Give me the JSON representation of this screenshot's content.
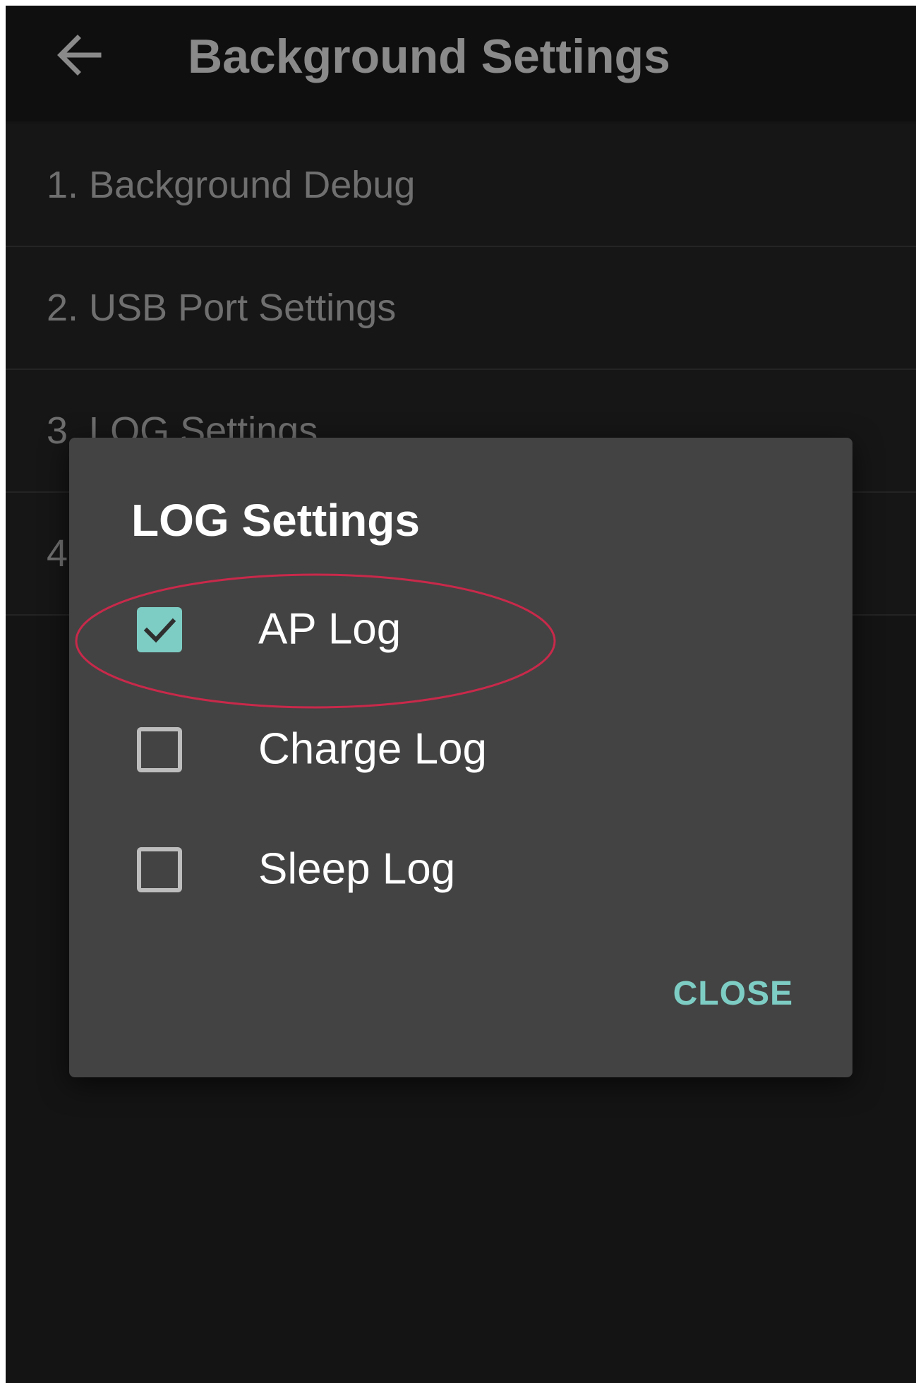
{
  "toolbar": {
    "title": "Background Settings",
    "back_icon": "arrow-left-icon"
  },
  "list": {
    "items": [
      {
        "label": "1. Background Debug"
      },
      {
        "label": "2. USB Port Settings"
      },
      {
        "label": "3. LOG Settings"
      },
      {
        "label": "4"
      }
    ]
  },
  "dialog": {
    "title": "LOG Settings",
    "options": [
      {
        "label": "AP Log",
        "checked": true
      },
      {
        "label": "Charge Log",
        "checked": false
      },
      {
        "label": "Sleep Log",
        "checked": false
      }
    ],
    "close_label": "CLOSE"
  },
  "colors": {
    "accent": "#7ecdc4",
    "dialog_bg": "#434343",
    "screen_bg": "#141414",
    "highlight": "#c8294a"
  }
}
